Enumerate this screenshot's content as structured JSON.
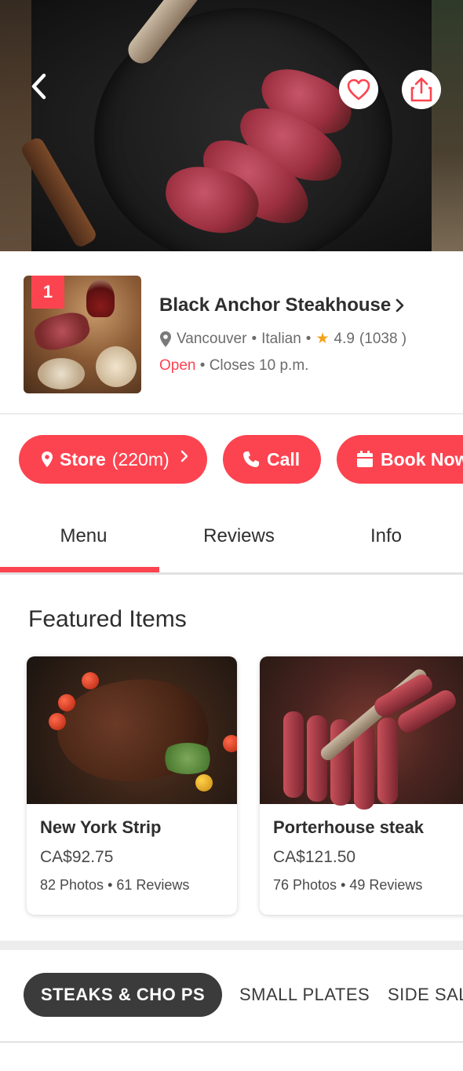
{
  "colors": {
    "accent": "#fc4450",
    "text": "#2e2e2e",
    "muted": "#6b6b6b",
    "star": "#f3a21b",
    "chip_active": "#3b3b3b"
  },
  "hero": {
    "back_icon": "chevron-left-icon",
    "favorite_icon": "heart-icon",
    "share_icon": "share-icon"
  },
  "store": {
    "rank": "1",
    "name": "Black Anchor Steakhouse",
    "city": "Vancouver",
    "cuisine": "Italian",
    "rating": "4.9",
    "review_count": "(1038 )",
    "status": "Open",
    "closes": "Closes 10 p.m."
  },
  "actions": {
    "store_label": "Store",
    "store_distance": "(220m)",
    "call_label": "Call",
    "book_label": "Book Now"
  },
  "tabs": [
    {
      "label": "Menu",
      "active": true
    },
    {
      "label": "Reviews",
      "active": false
    },
    {
      "label": "Info",
      "active": false
    }
  ],
  "featured": {
    "title": "Featured Items",
    "items": [
      {
        "name": "New York Strip",
        "price": "CA$92.75",
        "photos": "82 Photos",
        "reviews": "61 Reviews"
      },
      {
        "name": "Porterhouse steak",
        "price": "CA$121.50",
        "photos": "76 Photos",
        "reviews": "49 Reviews"
      }
    ]
  },
  "categories": [
    {
      "label": "STEAKS & CHO  PS",
      "active": true
    },
    {
      "label": "SMALL PLATES",
      "active": false
    },
    {
      "label": "SIDE SALA",
      "active": false
    }
  ]
}
